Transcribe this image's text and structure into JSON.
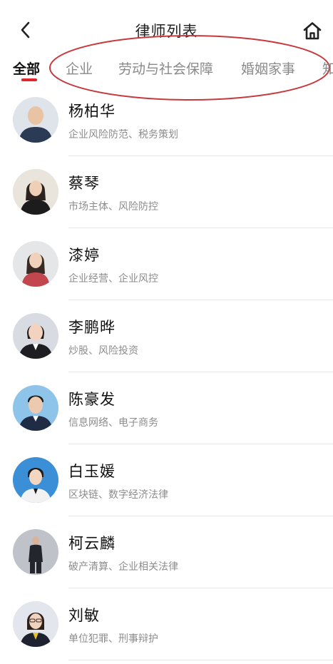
{
  "header": {
    "title": "律师列表",
    "back_icon": "chevron-left-icon",
    "home_icon": "home-icon"
  },
  "tabs": [
    {
      "label": "全部",
      "active": true
    },
    {
      "label": "企业",
      "active": false
    },
    {
      "label": "劳动与社会保障",
      "active": false
    },
    {
      "label": "婚姻家事",
      "active": false
    },
    {
      "label": "知",
      "active": false
    }
  ],
  "colors": {
    "accent": "#e0262b",
    "annotation": "#c8383c"
  },
  "lawyers": [
    {
      "name": "杨柏华",
      "specialties": "企业风险防范、税务策划",
      "avatar_bg": "#dfe3ea",
      "clothing": "#2b3a55"
    },
    {
      "name": "蔡琴",
      "specialties": "市场主体、风险防控",
      "avatar_bg": "#e9e4dc",
      "clothing": "#1c1c1c"
    },
    {
      "name": "漆婷",
      "specialties": "企业经营、企业风控",
      "avatar_bg": "#e5e6e8",
      "clothing": "#c2464e"
    },
    {
      "name": "李鹏晔",
      "specialties": "炒股、风险投资",
      "avatar_bg": "#d9dbe3",
      "clothing": "#1e1e22"
    },
    {
      "name": "陈豪发",
      "specialties": "信息网络、电子商务",
      "avatar_bg": "#8ec4ea",
      "clothing": "#1f2c44"
    },
    {
      "name": "白玉媛",
      "specialties": "区块链、数字经济法律",
      "avatar_bg": "#3b8fd6",
      "clothing": "#f2f2f2"
    },
    {
      "name": "柯云麟",
      "specialties": "破产清算、企业相关法律",
      "avatar_bg": "#bfc2c8",
      "clothing": "#23262d"
    },
    {
      "name": "刘敏",
      "specialties": "单位犯罪、刑事辩护",
      "avatar_bg": "#e3e6ec",
      "clothing": "#1e2230"
    }
  ]
}
